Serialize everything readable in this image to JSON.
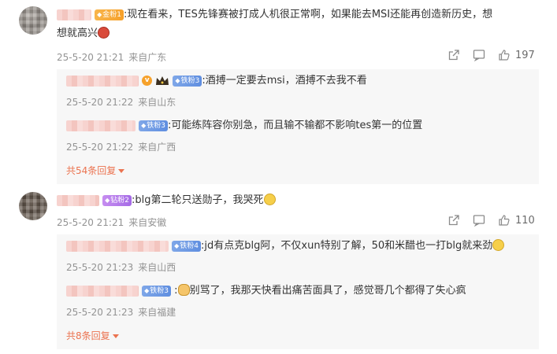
{
  "comments": [
    {
      "badge": "金粉1",
      "text": ":现在看来，TES先锋赛被打成人机很正常啊，如果能去MSI还能再创造新历史，想",
      "text2": "想就高兴",
      "time": "25-5-20 21:21",
      "location": "来自广东",
      "likes": "197",
      "replies": [
        {
          "badge": "铁粉3",
          "text": ":酒搏一定要去msi，酒搏不去我不看",
          "time": "25-5-20 21:22",
          "location": "来自山东"
        },
        {
          "badge": "铁粉3",
          "text": ":可能练阵容你别急，而且输不输都不影响tes第一的位置",
          "time": "25-5-20 21:22",
          "location": "来自广西"
        }
      ],
      "more": "共54条回复"
    },
    {
      "badge": "钻粉2",
      "text": ":blg第二轮只送勋子，我哭死",
      "time": "25-5-20 21:21",
      "location": "来自安徽",
      "likes": "110",
      "replies": [
        {
          "badge": "铁粉4",
          "text": ":jd有点克blg阿，不仅xun特别了解，50和米醋也一打blg就来劲",
          "time": "25-5-20 21:23",
          "location": "来自山西"
        },
        {
          "badge": "铁粉3",
          "text": "别骂了，我那天快看出痛苦面具了，感觉哥几个都得了失心疯",
          "time": "25-5-20 21:23",
          "location": "来自福建"
        }
      ],
      "more": "共8条回复"
    }
  ],
  "icons": {
    "share": "share-icon",
    "comment": "comment-icon",
    "like": "thumbs-up-icon"
  },
  "colors": {
    "accent": "#eb7350",
    "meta": "#939393"
  }
}
